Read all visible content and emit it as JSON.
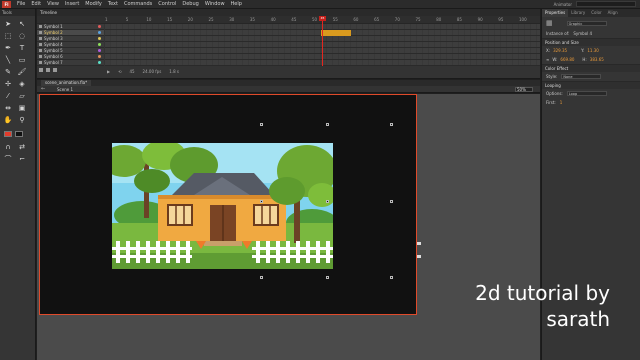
{
  "menu": {
    "logo": "Fl",
    "items": [
      "File",
      "Edit",
      "View",
      "Insert",
      "Modify",
      "Text",
      "Commands",
      "Control",
      "Debug",
      "Window",
      "Help"
    ],
    "workspace": "Animator"
  },
  "tools": {
    "header": "Tools"
  },
  "timeline": {
    "tab": "Timeline",
    "frame_numbers": [
      "1",
      "5",
      "10",
      "15",
      "20",
      "25",
      "30",
      "35",
      "40",
      "45",
      "50",
      "55",
      "60",
      "65",
      "70",
      "75",
      "80",
      "85",
      "90",
      "95",
      "100"
    ],
    "layers": [
      "Symbol 1",
      "Symbol 2",
      "Symbol 3",
      "Symbol 4",
      "Symbol 5",
      "Symbol 6",
      "Symbol 7"
    ],
    "playhead_frame": "45",
    "status_fps": "24.00 fps",
    "status_time": "1.8 s"
  },
  "document": {
    "tab": "scene_animation.fla*",
    "scene": "Scene 1",
    "zoom": "50%"
  },
  "properties": {
    "tabs": [
      "Properties",
      "Library",
      "Color",
      "Align"
    ],
    "instance_type": "Graphic",
    "instance_of_label": "Instance of:",
    "instance_of": "Symbol 4",
    "position_title": "Position and Size",
    "x_label": "X:",
    "x": "329.35",
    "y_label": "Y:",
    "y": "11.30",
    "w_label": "W:",
    "w": "669.80",
    "h_label": "H:",
    "h": "383.65",
    "color_effect_title": "Color Effect",
    "style_label": "Style:",
    "style": "None",
    "looping_title": "Looping",
    "options_label": "Options:",
    "options": "Loop",
    "first_label": "First:",
    "first": "1"
  },
  "caption": {
    "line1": "2d tutorial by",
    "line2": "sarath"
  },
  "colors": {
    "stage_border": "#e04a2a",
    "playhead": "#e3261f",
    "frame_selection": "#d99a1e"
  }
}
